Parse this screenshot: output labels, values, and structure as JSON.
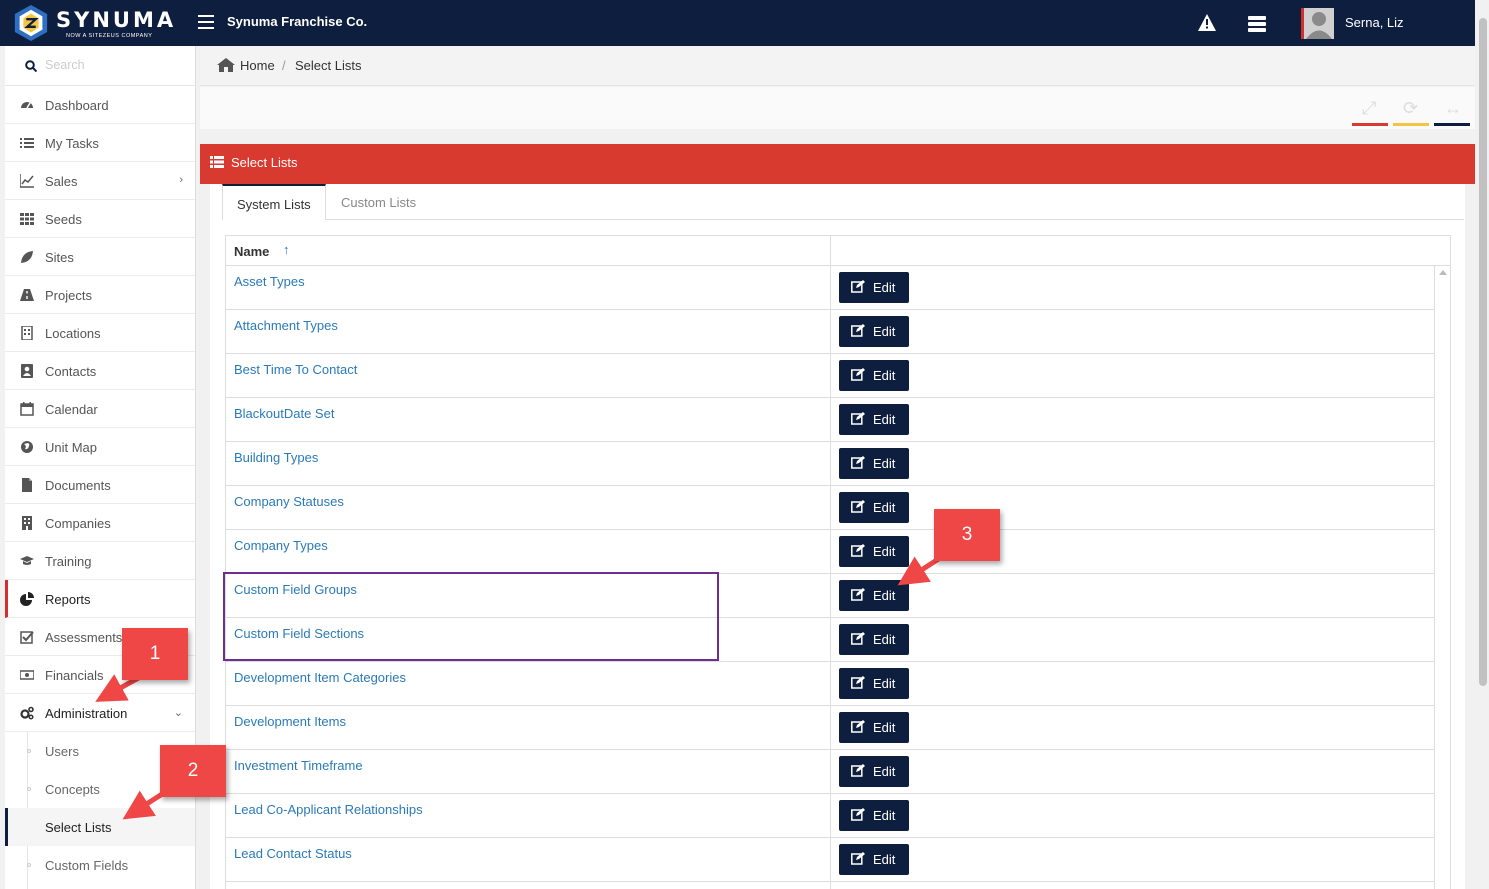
{
  "app": {
    "brand": "SYNUMA",
    "brand_tagline": "NOW A SITEZEUS COMPANY",
    "company_name": "Synuma Franchise Co.",
    "user_name": "Serna, Liz"
  },
  "colors": {
    "topbar": "#0e1e3f",
    "panel_header": "#d83a2f",
    "link": "#2a7ab8",
    "edit_button": "#0e1e3f",
    "annotation_box": "#6c2f8f",
    "callout": "#ef4646"
  },
  "sidebar": {
    "search_placeholder": "Search",
    "items": [
      {
        "label": "Dashboard",
        "icon": "dashboard-icon"
      },
      {
        "label": "My Tasks",
        "icon": "task-list-icon"
      },
      {
        "label": "Sales",
        "icon": "line-chart-icon",
        "has_chevron": true
      },
      {
        "label": "Seeds",
        "icon": "grid-icon"
      },
      {
        "label": "Sites",
        "icon": "leaf-icon"
      },
      {
        "label": "Projects",
        "icon": "road-icon"
      },
      {
        "label": "Locations",
        "icon": "building-icon"
      },
      {
        "label": "Contacts",
        "icon": "contact-card-icon"
      },
      {
        "label": "Calendar",
        "icon": "calendar-icon"
      },
      {
        "label": "Unit Map",
        "icon": "globe-icon"
      },
      {
        "label": "Documents",
        "icon": "document-icon"
      },
      {
        "label": "Companies",
        "icon": "office-building-icon"
      },
      {
        "label": "Training",
        "icon": "graduation-cap-icon"
      },
      {
        "label": "Reports",
        "icon": "pie-chart-icon",
        "active": true
      },
      {
        "label": "Assessments",
        "icon": "checkbox-icon"
      },
      {
        "label": "Financials",
        "icon": "money-icon"
      },
      {
        "label": "Administration",
        "icon": "gears-icon",
        "expanded": true
      }
    ],
    "sub_items": [
      {
        "label": "Users"
      },
      {
        "label": "Concepts"
      },
      {
        "label": "Select Lists",
        "current": true
      },
      {
        "label": "Custom Fields"
      }
    ]
  },
  "breadcrumb": {
    "home": "Home",
    "separator": "/",
    "current": "Select Lists"
  },
  "toolbar": {
    "tools": [
      {
        "icon": "expand-icon",
        "color": "#d83a2f"
      },
      {
        "icon": "refresh-icon",
        "color": "#f5c542"
      },
      {
        "icon": "horizontal-arrows-icon",
        "color": "#0e1e3f"
      }
    ]
  },
  "panel": {
    "title": "Select Lists",
    "tabs": [
      {
        "label": "System Lists",
        "active": true
      },
      {
        "label": "Custom Lists",
        "active": false
      }
    ],
    "grid": {
      "column_name": "Name",
      "sort_indicator": "↑",
      "edit_label": "Edit",
      "rows": [
        "Asset Types",
        "Attachment Types",
        "Best Time To Contact",
        "BlackoutDate Set",
        "Building Types",
        "Company Statuses",
        "Company Types",
        "Custom Field Groups",
        "Custom Field Sections",
        "Development Item Categories",
        "Development Items",
        "Investment Timeframe",
        "Lead Co-Applicant Relationships",
        "Lead Contact Status"
      ]
    }
  },
  "annotations": {
    "callouts": [
      "1",
      "2",
      "3"
    ]
  }
}
